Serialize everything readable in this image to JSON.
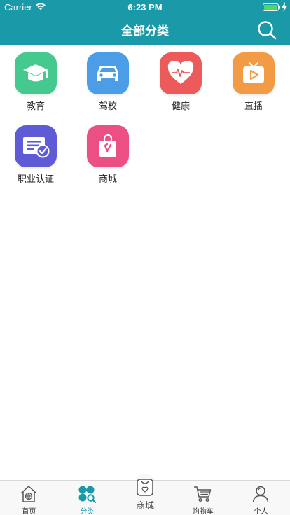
{
  "status_bar": {
    "carrier": "Carrier",
    "time": "6:23 PM",
    "battery_level": 1.0
  },
  "header": {
    "title": "全部分类"
  },
  "categories": [
    {
      "label": "教育",
      "icon": "graduation-cap-icon",
      "color": "#46c98f"
    },
    {
      "label": "驾校",
      "icon": "car-icon",
      "color": "#4b9de8"
    },
    {
      "label": "健康",
      "icon": "heartbeat-icon",
      "color": "#ec5a5a"
    },
    {
      "label": "直播",
      "icon": "tv-play-icon",
      "color": "#f39a45"
    },
    {
      "label": "职业认证",
      "icon": "certificate-icon",
      "color": "#5f5bd6"
    },
    {
      "label": "商城",
      "icon": "shopping-bag-icon",
      "color": "#ec4f83"
    }
  ],
  "tabbar": {
    "items": [
      {
        "label": "首页",
        "icon": "home-icon"
      },
      {
        "label": "分类",
        "icon": "clover-search-icon",
        "active": true
      },
      {
        "label": "商城",
        "icon": "bag-heart-icon"
      },
      {
        "label": "购物车",
        "icon": "cart-icon"
      },
      {
        "label": "个人",
        "icon": "person-icon"
      }
    ]
  },
  "colors": {
    "header": "#1a9aa8",
    "accent": "#1a9aa8"
  }
}
